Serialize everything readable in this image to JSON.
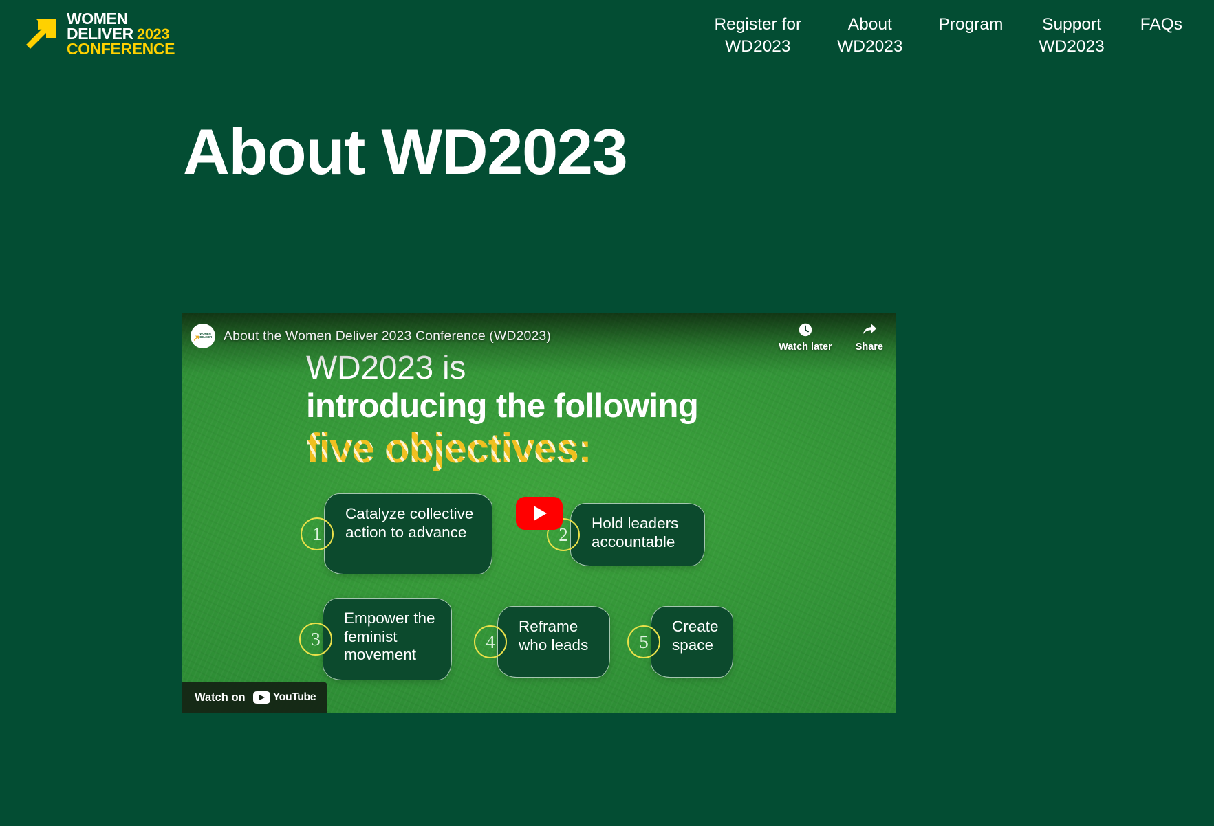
{
  "theme": {
    "page_bg": "#034d33",
    "brand_yellow": "#ffd100",
    "brand_white": "#ffffff",
    "poster_green": "#2f8f36",
    "card_green": "#0c4a2d",
    "youtube_red": "#ff0000"
  },
  "header": {
    "logo": {
      "icon": "diagonal-arrow-icon",
      "line1_white": "WOMEN",
      "line2_white": "DELIVER",
      "line2_yellow": "2023",
      "line3_yellow": "CONFERENCE"
    },
    "nav": [
      {
        "line1": "Register for",
        "line2": "WD2023"
      },
      {
        "line1": "About",
        "line2": "WD2023"
      },
      {
        "line1": "Program",
        "line2": ""
      },
      {
        "line1": "Support",
        "line2": "WD2023"
      },
      {
        "line1": "FAQs",
        "line2": ""
      }
    ]
  },
  "page": {
    "title": "About WD2023"
  },
  "video": {
    "title": "About the Women Deliver 2023 Conference (WD2023)",
    "channel_avatar_text_1": "WOMEN",
    "channel_avatar_text_2": "DELIVER",
    "actions": [
      {
        "label": "Watch later",
        "icon": "clock-icon"
      },
      {
        "label": "Share",
        "icon": "share-arrow-icon"
      }
    ],
    "play_button_label": "Play",
    "watch_on": {
      "label": "Watch on",
      "brand": "YouTube"
    },
    "poster": {
      "headline_line1": "WD2023 is",
      "headline_line2": "introducing the following",
      "headline_line3": "five objectives:",
      "objectives": [
        {
          "number": "1",
          "text": "Catalyze collective action to advance"
        },
        {
          "number": "2",
          "text": "Hold leaders accountable"
        },
        {
          "number": "3",
          "text": "Empower the feminist movement"
        },
        {
          "number": "4",
          "text": "Reframe who leads"
        },
        {
          "number": "5",
          "text": "Create space"
        }
      ]
    }
  }
}
